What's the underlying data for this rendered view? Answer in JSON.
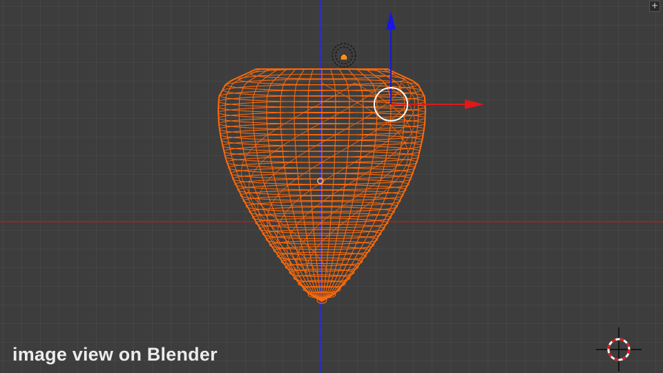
{
  "viewport": {
    "caption": "image view on Blender",
    "corner_button_icon": "plus-icon",
    "colors": {
      "background": "#3d3d3d",
      "grid": "#474747",
      "x_axis": "#b51e1e",
      "y_axis": "#2b2bd6",
      "wireframe": "#ff6a0a",
      "manipulator_x": "#e01818",
      "manipulator_z": "#1818e0"
    },
    "icons": [
      "translate-manipulator-icon",
      "lamp-icon",
      "origin-dot-icon",
      "3d-cursor-icon",
      "plus-icon"
    ]
  }
}
